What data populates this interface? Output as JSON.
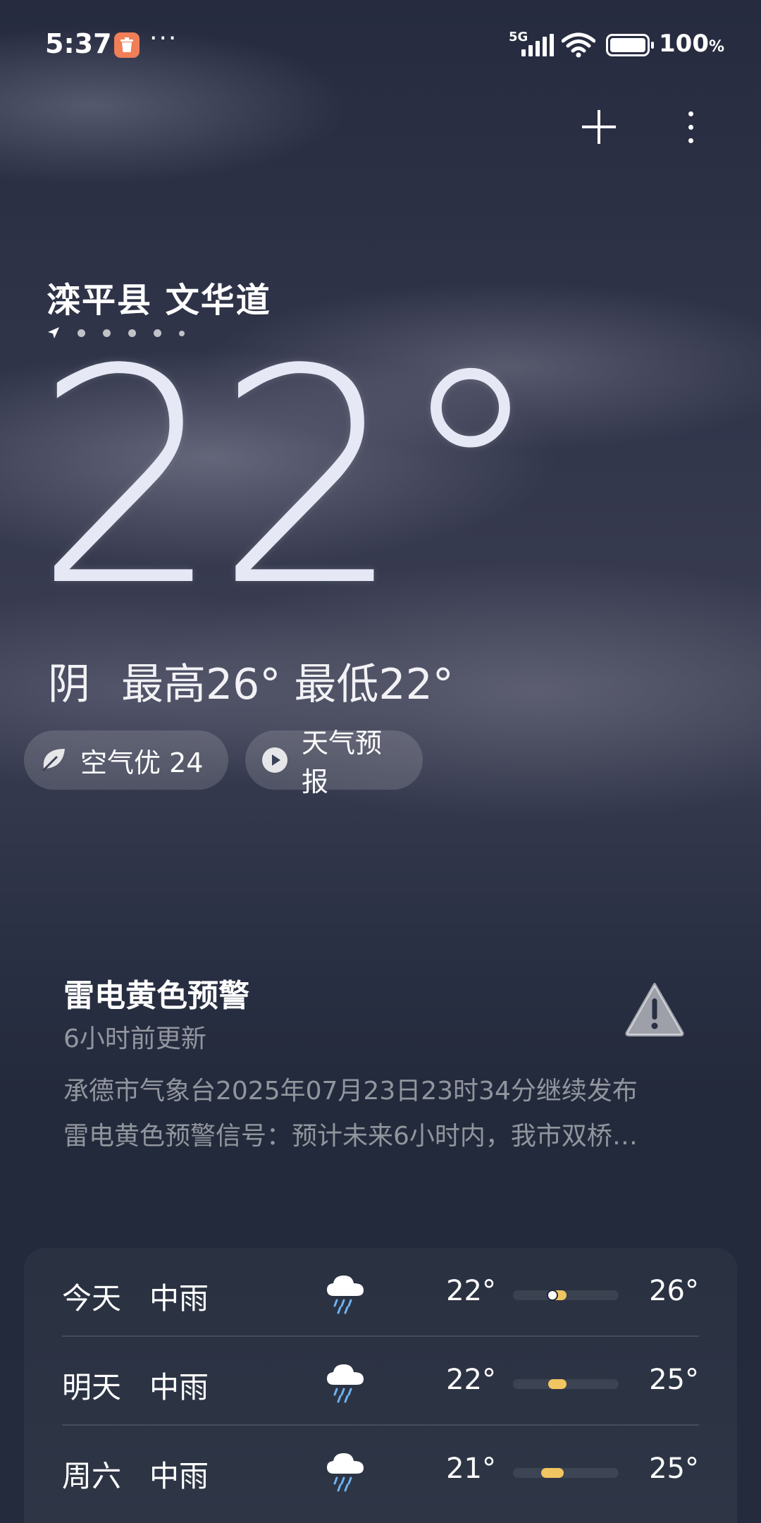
{
  "status_bar": {
    "time": "5:37",
    "more": "···",
    "network": "5G",
    "battery_percent": "100",
    "battery_unit": "%"
  },
  "location": "滦平县 文华道",
  "current": {
    "temperature": "22°",
    "condition": "阴",
    "high_low": "最高26° 最低22°"
  },
  "pills": {
    "aqi": "空气优 24",
    "forecast_video": "天气预报"
  },
  "alert": {
    "title": "雷电黄色预警",
    "updated": "6小时前更新",
    "line1": "承德市气象台2025年07月23日23时34分继续发布",
    "line2": "雷电黄色预警信号：预计未来6小时内，我市双桥…"
  },
  "daily": [
    {
      "day": "今天",
      "condition": "中雨",
      "icon": "rain-cloud-icon",
      "low": "22°",
      "high": "26°"
    },
    {
      "day": "明天",
      "condition": "中雨",
      "icon": "rain-cloud-icon",
      "low": "22°",
      "high": "25°"
    },
    {
      "day": "周六",
      "condition": "中雨",
      "icon": "rain-cloud-icon",
      "low": "21°",
      "high": "25°"
    }
  ],
  "colors": {
    "accent_bar": "#f1c561",
    "app_badge": "#f07e57"
  }
}
